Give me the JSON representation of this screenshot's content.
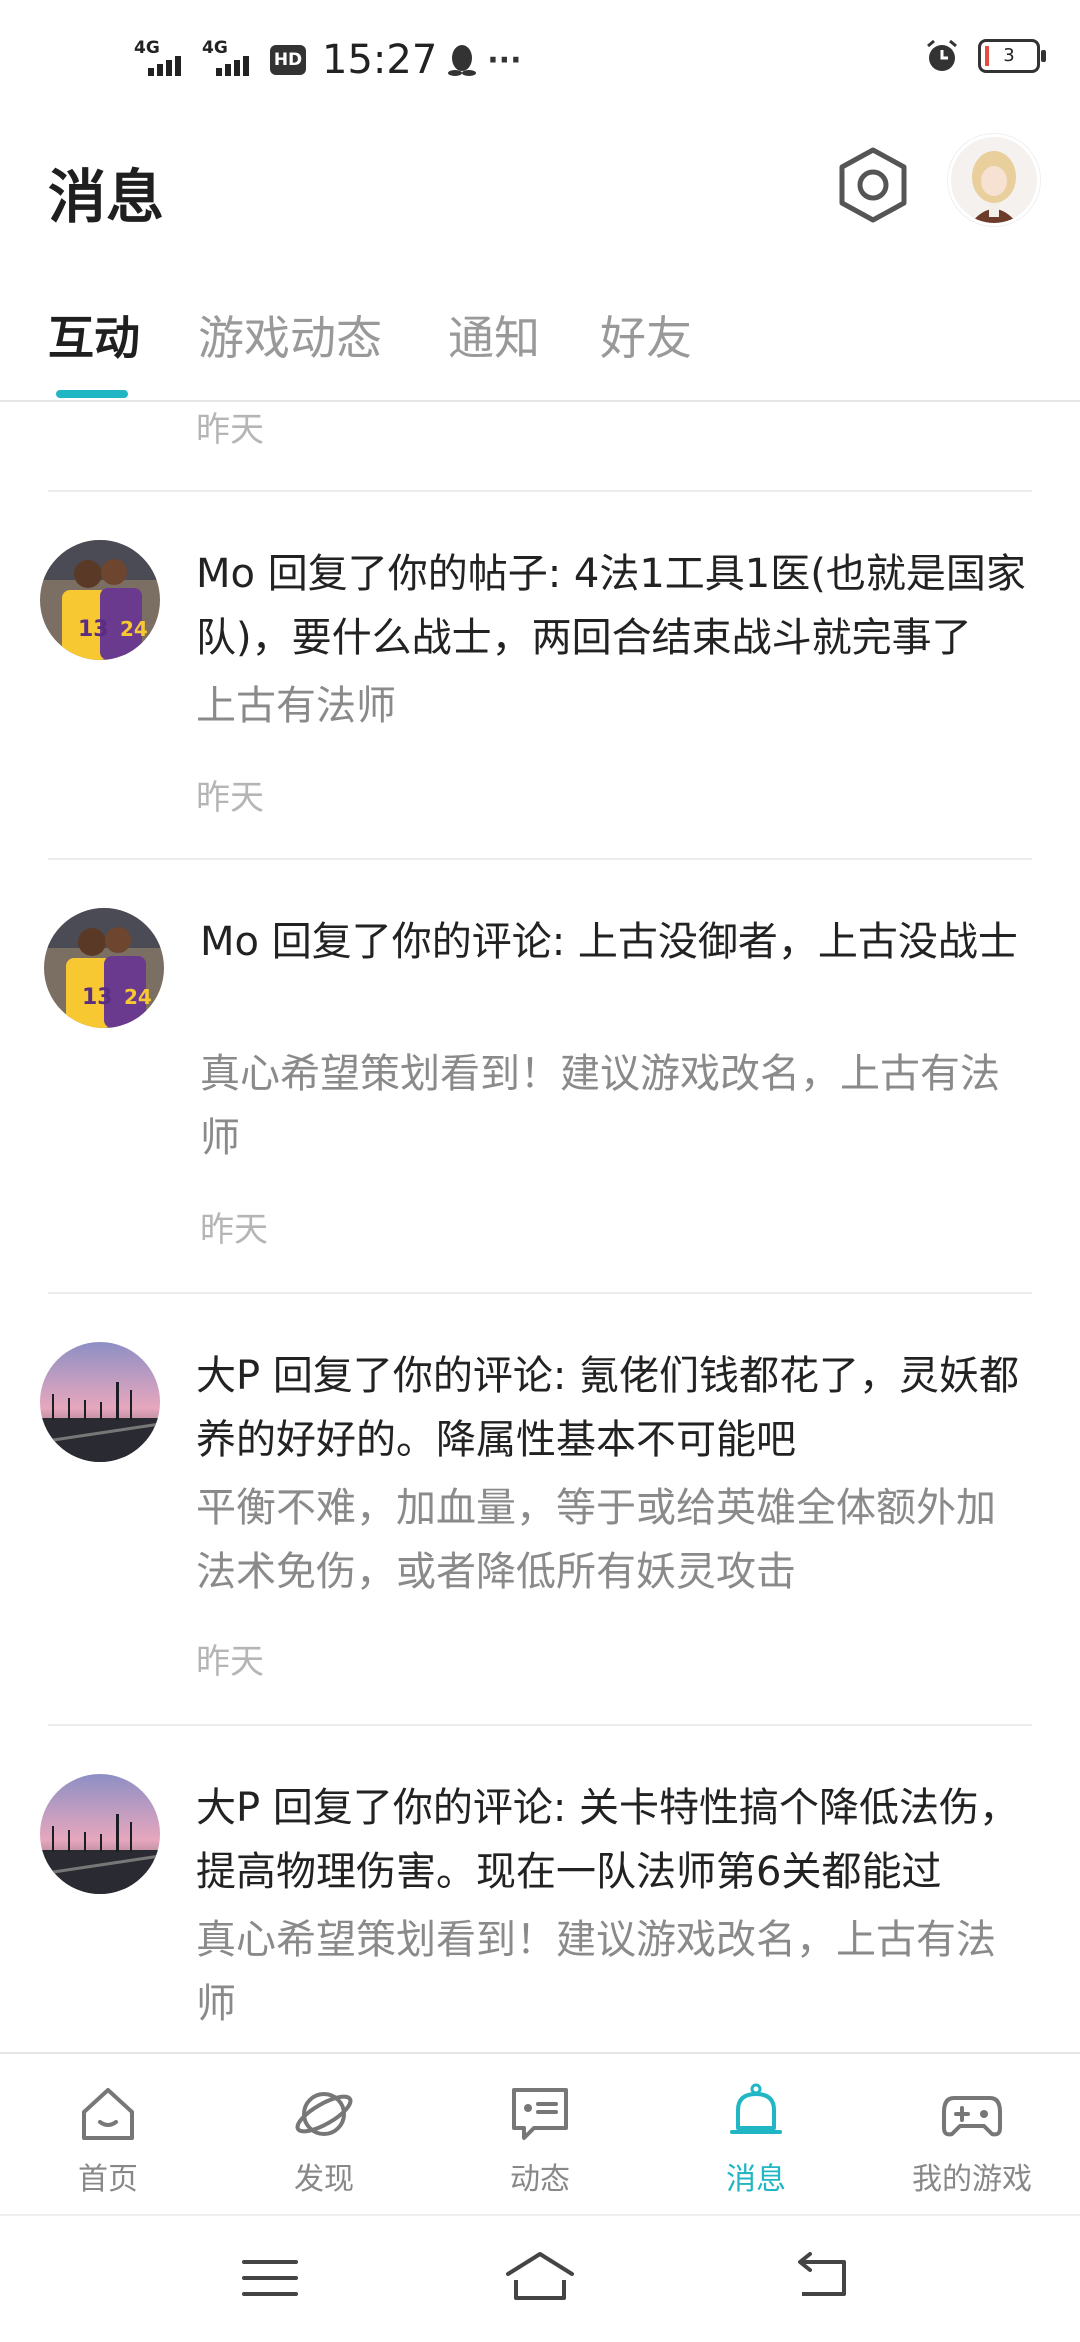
{
  "status_bar": {
    "net1": "4G",
    "net2": "4G",
    "hd": "HD",
    "time": "15:27",
    "more": "···",
    "battery": "3"
  },
  "header": {
    "title": "消息"
  },
  "tabs": [
    {
      "label": "互动",
      "active": true
    },
    {
      "label": "游戏动态",
      "active": false
    },
    {
      "label": "通知",
      "active": false
    },
    {
      "label": "好友",
      "active": false
    }
  ],
  "feed": {
    "top_time": "昨天",
    "messages": [
      {
        "title": "Mo 回复了你的帖子: 4法1工具1医(也就是国家队)，要什么战士，两回合结束战斗就完事了",
        "subtitle": "上古有法师",
        "time": "昨天",
        "avatar_icon": "basketball-players-avatar"
      },
      {
        "title": "Mo 回复了你的评论: 上古没御者，上古没战士",
        "subtitle": "真心希望策划看到！建议游戏改名，上古有法师",
        "time": "昨天",
        "avatar_icon": "basketball-players-avatar"
      },
      {
        "title": "大P 回复了你的评论: 氪佬们钱都花了，灵妖都养的好好的。降属性基本不可能吧",
        "subtitle": "平衡不难，加血量，等于或给英雄全体额外加法术免伤，或者降低所有妖灵攻击",
        "time": "昨天",
        "avatar_icon": "sunset-road-avatar"
      },
      {
        "title": "大P 回复了你的评论: 关卡特性搞个降低法伤，提高物理伤害。现在一队法师第6关都能过",
        "subtitle": "真心希望策划看到！建议游戏改名，上古有法师",
        "time": "",
        "avatar_icon": "sunset-road-avatar"
      }
    ]
  },
  "bottom_nav": [
    {
      "label": "首页",
      "icon": "home-icon",
      "active": false
    },
    {
      "label": "发现",
      "icon": "planet-icon",
      "active": false
    },
    {
      "label": "动态",
      "icon": "message-card-icon",
      "active": false
    },
    {
      "label": "消息",
      "icon": "bell-icon",
      "active": true
    },
    {
      "label": "我的游戏",
      "icon": "gamepad-icon",
      "active": false
    }
  ],
  "colors": {
    "accent": "#21b6c4",
    "text_primary": "#222222",
    "text_secondary": "#8a8a8a",
    "text_muted": "#b5b5b5"
  }
}
